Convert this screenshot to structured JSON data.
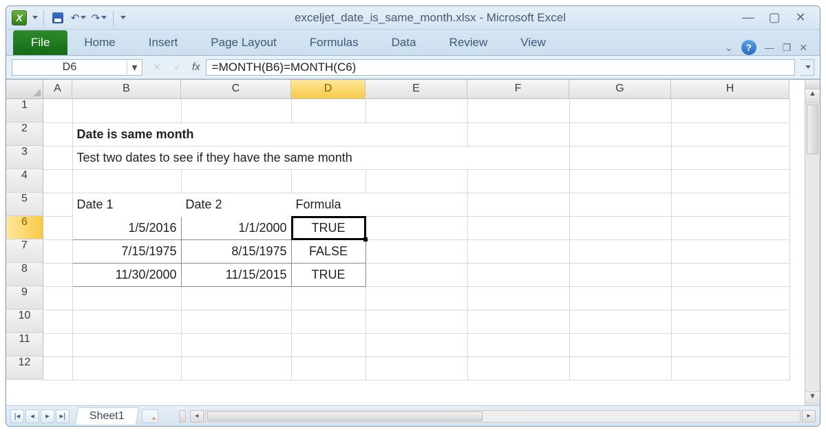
{
  "window": {
    "title": "exceljet_date_is_same_month.xlsx - Microsoft Excel"
  },
  "ribbon": {
    "file": "File",
    "tabs": [
      "Home",
      "Insert",
      "Page Layout",
      "Formulas",
      "Data",
      "Review",
      "View"
    ]
  },
  "namebox": "D6",
  "fx_label": "fx",
  "formula": "=MONTH(B6)=MONTH(C6)",
  "columns": [
    "A",
    "B",
    "C",
    "D",
    "E",
    "F",
    "G",
    "H"
  ],
  "active_col": "D",
  "rows": [
    "1",
    "2",
    "3",
    "4",
    "5",
    "6",
    "7",
    "8",
    "9",
    "10",
    "11",
    "12"
  ],
  "active_row": "6",
  "content": {
    "title": "Date is same month",
    "subtitle": "Test two dates to see if they have the same month",
    "headers": {
      "b": "Date 1",
      "c": "Date 2",
      "d": "Formula"
    },
    "data": [
      {
        "b": "1/5/2016",
        "c": "1/1/2000",
        "d": "TRUE"
      },
      {
        "b": "7/15/1975",
        "c": "8/15/1975",
        "d": "FALSE"
      },
      {
        "b": "11/30/2000",
        "c": "11/15/2015",
        "d": "TRUE"
      }
    ]
  },
  "sheets": {
    "active": "Sheet1"
  }
}
